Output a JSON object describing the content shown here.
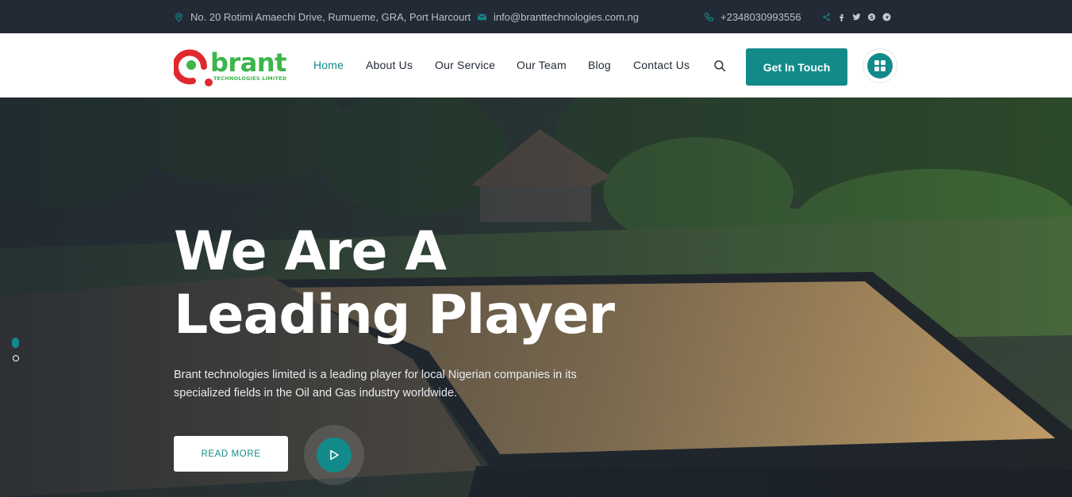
{
  "topbar": {
    "address": "No. 20 Rotimi Amaechi Drive, Rumueme, GRA, Port Harcourt",
    "email": "info@branttechnologies.com.ng",
    "phone": "+2348030993556",
    "social_icons": [
      "share-icon",
      "facebook-icon",
      "twitter-icon",
      "skype-icon",
      "telegram-icon"
    ]
  },
  "logo": {
    "text": "brant",
    "subtext": "TECHNOLOGIES LIMITED"
  },
  "nav": {
    "items": [
      {
        "label": "Home",
        "active": true
      },
      {
        "label": "About Us"
      },
      {
        "label": "Our Service"
      },
      {
        "label": "Our Team"
      },
      {
        "label": "Blog"
      },
      {
        "label": "Contact Us"
      }
    ],
    "cta_label": "Get In Touch"
  },
  "hero": {
    "title_line1": "We Are A",
    "title_line2": "Leading Player",
    "description": "Brant technologies limited is a leading player for local Nigerian companies in its specialized fields in the Oil and Gas industry worldwide.",
    "read_more_label": "READ MORE"
  },
  "colors": {
    "accent": "#138a8a",
    "topbar_bg": "#222a35",
    "logo_red": "#e0292f",
    "logo_green": "#3cb54a"
  }
}
